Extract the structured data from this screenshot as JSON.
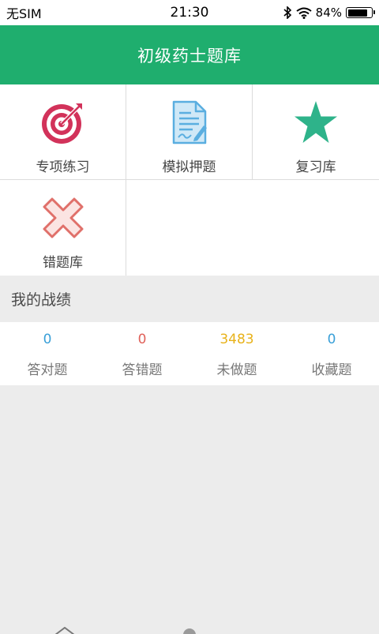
{
  "status_bar": {
    "carrier": "无SIM",
    "time": "21:30",
    "battery_percent_text": "84%",
    "battery_level": 0.84
  },
  "header": {
    "title": "初级药士题库"
  },
  "menu": [
    {
      "label": "专项练习",
      "icon": "target-icon",
      "color": "#d2325a"
    },
    {
      "label": "模拟押题",
      "icon": "document-pen-icon",
      "color": "#5aaee0"
    },
    {
      "label": "复习库",
      "icon": "star-icon",
      "color": "#2eb38a"
    },
    {
      "label": "错题库",
      "icon": "x-cross-icon",
      "color": "#e0706a"
    }
  ],
  "record": {
    "title": "我的战绩",
    "stats": [
      {
        "value": "0",
        "label": "答对题",
        "color": "#3aa0d8"
      },
      {
        "value": "0",
        "label": "答错题",
        "color": "#e0625a"
      },
      {
        "value": "3483",
        "label": "未做题",
        "color": "#e8b21a"
      },
      {
        "value": "0",
        "label": "收藏题",
        "color": "#3aa0d8"
      }
    ]
  },
  "colors": {
    "accent": "#1fae6e",
    "background": "#ececec"
  }
}
